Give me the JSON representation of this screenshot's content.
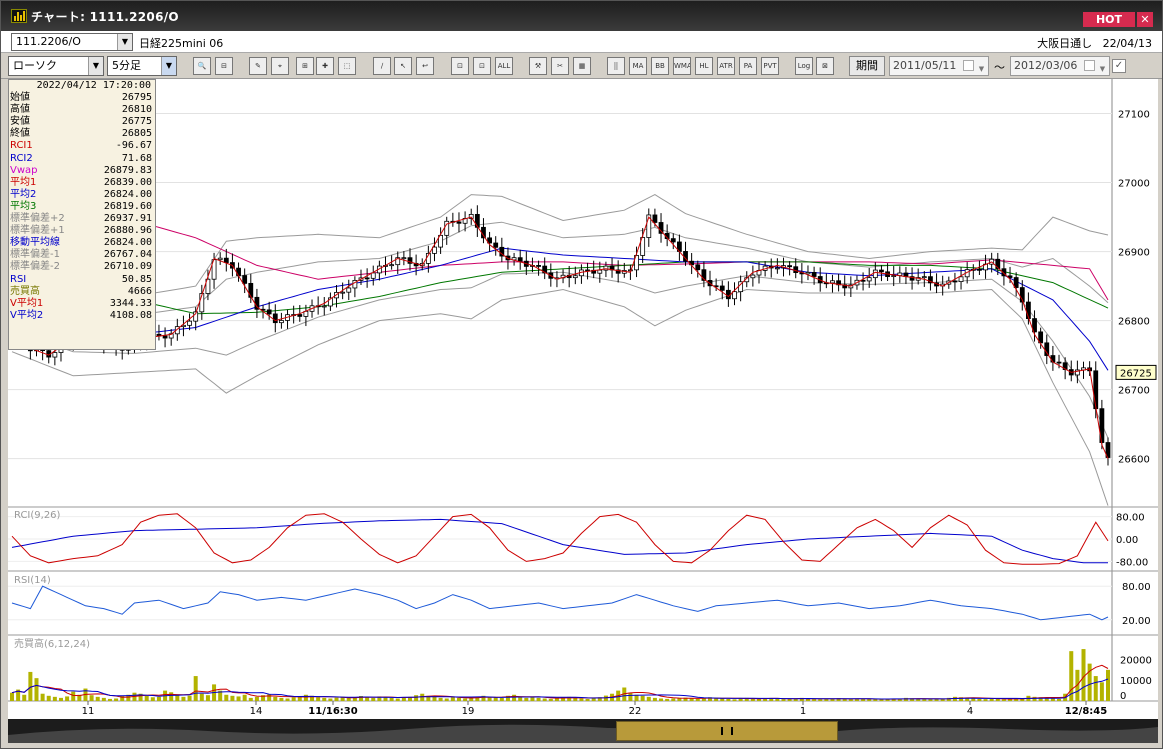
{
  "window": {
    "title": "チャート: 1111.2206/O",
    "hot_label": "HOT",
    "close_label": "✕"
  },
  "symbol_bar": {
    "symbol": "111.2206/O",
    "instrument_name": "日経225mini 06",
    "session": "大阪日通し",
    "date": "22/04/13"
  },
  "toolbar": {
    "chart_type": "ローソク",
    "interval": "5分足",
    "buttons": [
      "🔍",
      "⊟",
      "✎",
      "⌖",
      "⊞",
      "✚",
      "⬚",
      "∕",
      "↖",
      "↩",
      "⊡",
      "⊡",
      "ALL",
      "⚒",
      "✂",
      "▦",
      "⣿",
      "MA",
      "BB",
      "WMA",
      "HL",
      "ATR",
      "PA",
      "PVT",
      "Log",
      "⊠"
    ],
    "period_label": "期間",
    "date_from": "2011/05/11",
    "date_to": "2012/03/06",
    "tilde": "〜",
    "check": "✓"
  },
  "info_panel": {
    "timestamp": "2022/04/12  17:20:00",
    "rows": [
      {
        "label": "始値",
        "value": "26795",
        "color": "#000000"
      },
      {
        "label": "高値",
        "value": "26810",
        "color": "#000000"
      },
      {
        "label": "安値",
        "value": "26775",
        "color": "#000000"
      },
      {
        "label": "終値",
        "value": "26805",
        "color": "#000000"
      },
      {
        "label": "RCI1",
        "value": "-96.67",
        "color": "#cc0000"
      },
      {
        "label": "RCI2",
        "value": "71.68",
        "color": "#0000cc"
      },
      {
        "label": "Vwap",
        "value": "26879.83",
        "color": "#cc00cc"
      },
      {
        "label": "平均1",
        "value": "26839.00",
        "color": "#cc0000"
      },
      {
        "label": "平均2",
        "value": "26824.00",
        "color": "#0000cc"
      },
      {
        "label": "平均3",
        "value": "26819.60",
        "color": "#007700"
      },
      {
        "label": "標準偏差+2",
        "value": "26937.91",
        "color": "#888888"
      },
      {
        "label": "標準偏差+1",
        "value": "26880.96",
        "color": "#888888"
      },
      {
        "label": "移動平均線",
        "value": "26824.00",
        "color": "#0000cc"
      },
      {
        "label": "標準偏差-1",
        "value": "26767.04",
        "color": "#888888"
      },
      {
        "label": "標準偏差-2",
        "value": "26710.09",
        "color": "#888888"
      },
      {
        "label": "RSI",
        "value": "50.85",
        "color": "#0000cc"
      },
      {
        "label": "売買高",
        "value": "4666",
        "color": "#777700"
      },
      {
        "label": "V平均1",
        "value": "3344.33",
        "color": "#cc0000"
      },
      {
        "label": "V平均2",
        "value": "4108.08",
        "color": "#0000cc"
      }
    ]
  },
  "chart_data": {
    "type": "candlestick",
    "price_axis": {
      "ticks": [
        27100,
        27000,
        26900,
        26800,
        26700,
        26600
      ],
      "range": [
        26530,
        27150
      ],
      "current_price": "26725"
    },
    "x_labels": [
      "11",
      "14",
      "11/16:30",
      "19",
      "22",
      "1",
      "4",
      "12/8:45"
    ],
    "bold_x_labels": [
      "11/16:30",
      "12/8:45"
    ],
    "rci": {
      "label": "RCI(9,26)",
      "ticks": [
        "80.00",
        "0.00",
        "-80.00"
      ],
      "range": [
        -100,
        100
      ]
    },
    "rsi": {
      "label": "RSI(14)",
      "ticks": [
        "80.00",
        "20.00"
      ],
      "range": [
        0,
        100
      ]
    },
    "volume": {
      "label": "売買高(6,12,24)",
      "ticks": [
        "20000",
        "10000",
        "0"
      ],
      "range": [
        0,
        26000
      ]
    },
    "colors": {
      "up": "#ffffff",
      "down": "#000000",
      "ma1": "#cc0000",
      "ma2": "#0000cc",
      "ma3": "#007700",
      "vwap": "#cc0066",
      "band": "#9a9a9a",
      "volume": "#b3b300"
    },
    "close_path": [
      [
        0,
        26815
      ],
      [
        3,
        26760
      ],
      [
        6,
        26750
      ],
      [
        10,
        26775
      ],
      [
        14,
        26770
      ],
      [
        18,
        26760
      ],
      [
        22,
        26775
      ],
      [
        26,
        26780
      ],
      [
        30,
        26810
      ],
      [
        33,
        26890
      ],
      [
        36,
        26880
      ],
      [
        40,
        26820
      ],
      [
        43,
        26800
      ],
      [
        47,
        26810
      ],
      [
        51,
        26825
      ],
      [
        55,
        26850
      ],
      [
        59,
        26870
      ],
      [
        63,
        26890
      ],
      [
        67,
        26880
      ],
      [
        71,
        26940
      ],
      [
        75,
        26950
      ],
      [
        78,
        26910
      ],
      [
        81,
        26890
      ],
      [
        85,
        26880
      ],
      [
        89,
        26860
      ],
      [
        93,
        26870
      ],
      [
        97,
        26875
      ],
      [
        101,
        26870
      ],
      [
        104,
        26950
      ],
      [
        107,
        26920
      ],
      [
        110,
        26890
      ],
      [
        113,
        26860
      ],
      [
        117,
        26835
      ],
      [
        121,
        26870
      ],
      [
        125,
        26880
      ],
      [
        129,
        26870
      ],
      [
        133,
        26855
      ],
      [
        137,
        26850
      ],
      [
        141,
        26870
      ],
      [
        145,
        26865
      ],
      [
        149,
        26860
      ],
      [
        152,
        26850
      ],
      [
        156,
        26870
      ],
      [
        160,
        26885
      ],
      [
        163,
        26860
      ],
      [
        165,
        26830
      ],
      [
        167,
        26780
      ],
      [
        170,
        26740
      ],
      [
        173,
        26725
      ],
      [
        176,
        26730
      ],
      [
        178,
        26620
      ],
      [
        180,
        26580
      ],
      [
        181,
        26600
      ]
    ],
    "mid_band": [
      [
        0,
        26815
      ],
      [
        10,
        26790
      ],
      [
        20,
        26780
      ],
      [
        30,
        26790
      ],
      [
        40,
        26820
      ],
      [
        50,
        26845
      ],
      [
        60,
        26860
      ],
      [
        70,
        26880
      ],
      [
        80,
        26905
      ],
      [
        90,
        26895
      ],
      [
        100,
        26890
      ],
      [
        110,
        26885
      ],
      [
        120,
        26885
      ],
      [
        130,
        26870
      ],
      [
        140,
        26865
      ],
      [
        150,
        26870
      ],
      [
        160,
        26875
      ],
      [
        170,
        26830
      ],
      [
        176,
        26770
      ],
      [
        181,
        26700
      ]
    ],
    "ma3_line": [
      [
        0,
        26930
      ],
      [
        10,
        26870
      ],
      [
        20,
        26830
      ],
      [
        30,
        26810
      ],
      [
        40,
        26812
      ],
      [
        50,
        26820
      ],
      [
        60,
        26835
      ],
      [
        70,
        26855
      ],
      [
        80,
        26870
      ],
      [
        90,
        26875
      ],
      [
        100,
        26880
      ],
      [
        110,
        26885
      ],
      [
        120,
        26885
      ],
      [
        130,
        26885
      ],
      [
        140,
        26880
      ],
      [
        150,
        26880
      ],
      [
        160,
        26875
      ],
      [
        170,
        26855
      ],
      [
        181,
        26810
      ]
    ],
    "vwap_line": [
      [
        0,
        26975
      ],
      [
        10,
        26960
      ],
      [
        20,
        26945
      ],
      [
        30,
        26920
      ],
      [
        40,
        26880
      ],
      [
        50,
        26860
      ],
      [
        60,
        26870
      ],
      [
        70,
        26880
      ],
      [
        80,
        26885
      ],
      [
        90,
        26885
      ],
      [
        100,
        26880
      ],
      [
        110,
        26882
      ],
      [
        120,
        26885
      ],
      [
        130,
        26885
      ],
      [
        140,
        26885
      ],
      [
        150,
        26882
      ],
      [
        160,
        26888
      ],
      [
        170,
        26880
      ],
      [
        176,
        26875
      ],
      [
        181,
        26800
      ]
    ],
    "band_spread": [
      [
        0,
        60
      ],
      [
        10,
        70
      ],
      [
        20,
        55
      ],
      [
        30,
        60
      ],
      [
        35,
        110
      ],
      [
        40,
        100
      ],
      [
        50,
        80
      ],
      [
        60,
        60
      ],
      [
        70,
        70
      ],
      [
        75,
        90
      ],
      [
        80,
        75
      ],
      [
        90,
        50
      ],
      [
        100,
        70
      ],
      [
        105,
        95
      ],
      [
        110,
        70
      ],
      [
        120,
        40
      ],
      [
        130,
        30
      ],
      [
        140,
        25
      ],
      [
        150,
        30
      ],
      [
        160,
        30
      ],
      [
        165,
        50
      ],
      [
        170,
        120
      ],
      [
        176,
        160
      ],
      [
        181,
        220
      ]
    ],
    "rci_fast_path": [
      [
        0,
        10
      ],
      [
        3,
        -60
      ],
      [
        6,
        -85
      ],
      [
        10,
        -70
      ],
      [
        14,
        -60
      ],
      [
        18,
        -20
      ],
      [
        21,
        60
      ],
      [
        24,
        85
      ],
      [
        27,
        90
      ],
      [
        30,
        40
      ],
      [
        33,
        -50
      ],
      [
        36,
        -85
      ],
      [
        39,
        -75
      ],
      [
        42,
        -30
      ],
      [
        45,
        40
      ],
      [
        48,
        85
      ],
      [
        51,
        90
      ],
      [
        54,
        60
      ],
      [
        57,
        0
      ],
      [
        60,
        -55
      ],
      [
        63,
        -85
      ],
      [
        66,
        -60
      ],
      [
        69,
        10
      ],
      [
        72,
        80
      ],
      [
        75,
        88
      ],
      [
        78,
        40
      ],
      [
        81,
        -40
      ],
      [
        84,
        -80
      ],
      [
        87,
        -70
      ],
      [
        90,
        -50
      ],
      [
        93,
        20
      ],
      [
        96,
        80
      ],
      [
        99,
        88
      ],
      [
        102,
        60
      ],
      [
        105,
        -20
      ],
      [
        108,
        -80
      ],
      [
        111,
        -85
      ],
      [
        114,
        -40
      ],
      [
        117,
        30
      ],
      [
        120,
        85
      ],
      [
        123,
        70
      ],
      [
        126,
        -10
      ],
      [
        129,
        -75
      ],
      [
        132,
        -80
      ],
      [
        135,
        -20
      ],
      [
        138,
        40
      ],
      [
        141,
        70
      ],
      [
        144,
        30
      ],
      [
        147,
        -30
      ],
      [
        150,
        40
      ],
      [
        153,
        85
      ],
      [
        156,
        50
      ],
      [
        159,
        -40
      ],
      [
        162,
        -85
      ],
      [
        165,
        -90
      ],
      [
        168,
        -90
      ],
      [
        171,
        -88
      ],
      [
        174,
        -60
      ],
      [
        177,
        60
      ],
      [
        180,
        -40
      ],
      [
        181,
        -20
      ]
    ],
    "rci_slow_path": [
      [
        0,
        -30
      ],
      [
        10,
        10
      ],
      [
        20,
        30
      ],
      [
        30,
        35
      ],
      [
        40,
        40
      ],
      [
        50,
        55
      ],
      [
        60,
        65
      ],
      [
        70,
        70
      ],
      [
        80,
        55
      ],
      [
        90,
        -20
      ],
      [
        100,
        -55
      ],
      [
        110,
        -50
      ],
      [
        120,
        -20
      ],
      [
        130,
        0
      ],
      [
        140,
        10
      ],
      [
        150,
        20
      ],
      [
        160,
        10
      ],
      [
        165,
        -40
      ],
      [
        170,
        -70
      ],
      [
        175,
        -85
      ],
      [
        181,
        -85
      ]
    ],
    "rsi_path": [
      [
        0,
        50
      ],
      [
        3,
        40
      ],
      [
        5,
        80
      ],
      [
        8,
        65
      ],
      [
        12,
        45
      ],
      [
        15,
        40
      ],
      [
        18,
        30
      ],
      [
        20,
        50
      ],
      [
        24,
        55
      ],
      [
        28,
        40
      ],
      [
        32,
        50
      ],
      [
        34,
        70
      ],
      [
        37,
        65
      ],
      [
        40,
        55
      ],
      [
        44,
        60
      ],
      [
        48,
        55
      ],
      [
        52,
        65
      ],
      [
        56,
        75
      ],
      [
        60,
        65
      ],
      [
        63,
        55
      ],
      [
        66,
        40
      ],
      [
        69,
        50
      ],
      [
        72,
        65
      ],
      [
        75,
        55
      ],
      [
        78,
        40
      ],
      [
        82,
        45
      ],
      [
        86,
        50
      ],
      [
        90,
        40
      ],
      [
        94,
        45
      ],
      [
        98,
        50
      ],
      [
        102,
        65
      ],
      [
        105,
        55
      ],
      [
        108,
        45
      ],
      [
        112,
        35
      ],
      [
        115,
        45
      ],
      [
        120,
        50
      ],
      [
        125,
        55
      ],
      [
        130,
        45
      ],
      [
        135,
        50
      ],
      [
        140,
        40
      ],
      [
        145,
        45
      ],
      [
        150,
        55
      ],
      [
        155,
        45
      ],
      [
        160,
        40
      ],
      [
        165,
        30
      ],
      [
        168,
        20
      ],
      [
        172,
        25
      ],
      [
        176,
        30
      ],
      [
        178,
        20
      ],
      [
        180,
        30
      ],
      [
        181,
        35
      ]
    ],
    "volume_bars": [
      4000,
      5500,
      3000,
      14000,
      11000,
      3500,
      2500,
      2000,
      1500,
      2200,
      4500,
      3000,
      6000,
      2800,
      2000,
      1500,
      1000,
      1200,
      2500,
      3000,
      4000,
      3500,
      2500,
      1800,
      2000,
      5000,
      4200,
      3000,
      2000,
      2600,
      12000,
      3500,
      2800,
      8000,
      5000,
      3000,
      2500,
      2200,
      3000,
      1500,
      2000,
      2800,
      3200,
      2000,
      1500,
      1200,
      1800,
      2200,
      3000,
      2500,
      1800,
      1500,
      1200,
      1600,
      2000,
      1500,
      1800,
      2400,
      1800,
      1500,
      2200,
      1800,
      1500,
      1200,
      1800,
      2000,
      2800,
      3500,
      2500,
      2000,
      1500,
      1200,
      1800,
      1500,
      1200,
      1600,
      2000,
      2500,
      2000,
      1800,
      1500,
      2500,
      3000,
      2000,
      1500,
      1800,
      1500,
      1200,
      1000,
      1500,
      1800,
      2000,
      1500,
      1200,
      1000,
      1400,
      1800,
      2600,
      3500,
      5000,
      6500,
      4000,
      3000,
      2500,
      2000,
      1500,
      1200,
      1000,
      1200,
      1500,
      1600,
      1200,
      1000,
      1400,
      1800,
      1500,
      1300,
      1000,
      800,
      1200,
      1500,
      1200,
      1000,
      1200,
      1400,
      1100,
      900,
      1000,
      1200,
      1500,
      1000,
      900,
      800,
      1000,
      1200,
      1400,
      1000,
      800,
      900,
      1000,
      1200,
      800,
      700,
      900,
      1000,
      1200,
      1500,
      1300,
      1000,
      900,
      800,
      1000,
      1200,
      1500,
      2000,
      1800,
      1500,
      1200,
      1000,
      900,
      1000,
      1200,
      800,
      900,
      1200,
      1000,
      2500,
      2000,
      1800,
      1500,
      1200,
      1000,
      3500,
      24000,
      15000,
      25000,
      18000,
      12000,
      9000,
      15000
    ]
  }
}
